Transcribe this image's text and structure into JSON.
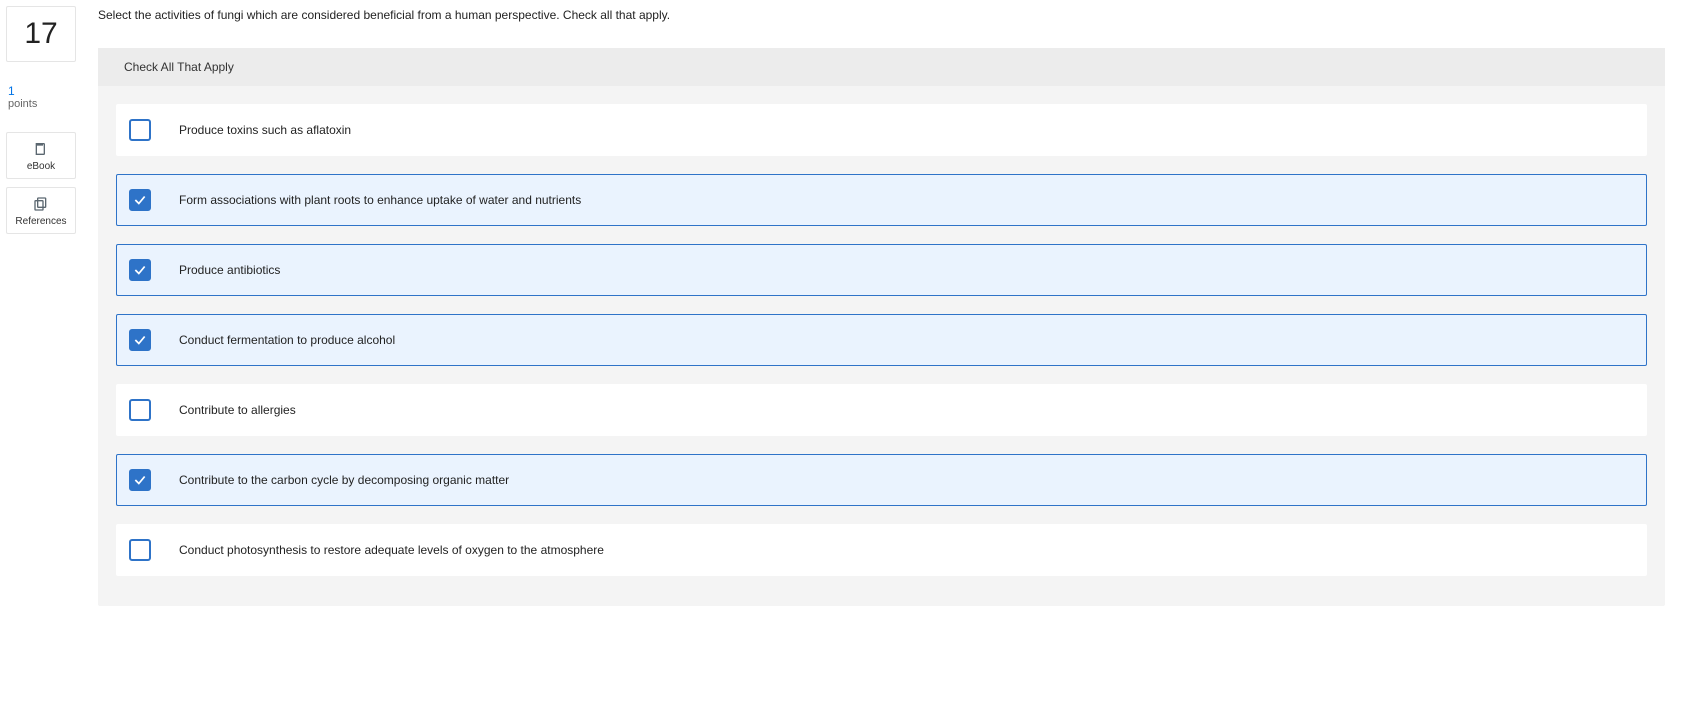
{
  "sidebar": {
    "question_number": "17",
    "points_value": "1",
    "points_label": "points",
    "tools": [
      {
        "label": "eBook",
        "icon": "book-icon"
      },
      {
        "label": "References",
        "icon": "copy-icon"
      }
    ]
  },
  "question": {
    "text": "Select the activities of fungi which are considered beneficial from a human perspective. Check all that apply."
  },
  "panel": {
    "header": "Check All That Apply"
  },
  "options": [
    {
      "label": "Produce toxins such as aflatoxin",
      "checked": false
    },
    {
      "label": "Form associations with plant roots to enhance uptake of water and nutrients",
      "checked": true
    },
    {
      "label": "Produce antibiotics",
      "checked": true
    },
    {
      "label": "Conduct fermentation to produce alcohol",
      "checked": true
    },
    {
      "label": "Contribute to allergies",
      "checked": false
    },
    {
      "label": "Contribute to the carbon cycle by decomposing organic matter",
      "checked": true
    },
    {
      "label": "Conduct photosynthesis to restore adequate levels of oxygen to the atmosphere",
      "checked": false
    }
  ]
}
